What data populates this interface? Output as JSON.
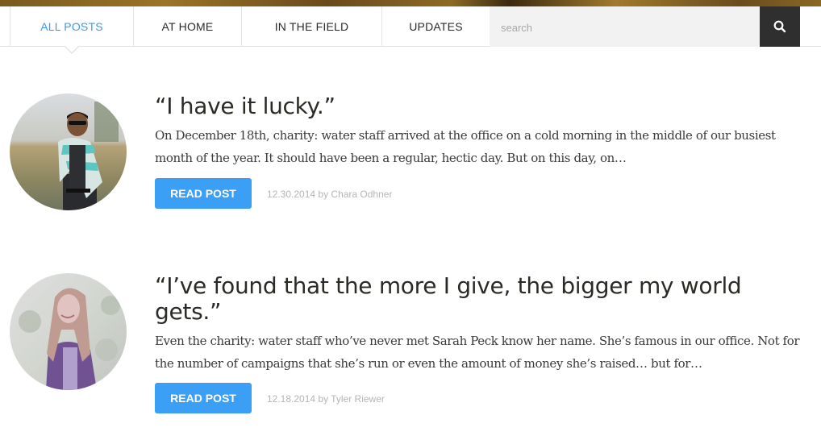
{
  "nav": {
    "tabs": [
      {
        "label": "ALL POSTS",
        "active": true
      },
      {
        "label": "AT HOME",
        "active": false
      },
      {
        "label": "IN THE FIELD",
        "active": false
      },
      {
        "label": "UPDATES",
        "active": false
      }
    ],
    "search": {
      "placeholder": "search",
      "value": "",
      "icon": "search-icon"
    }
  },
  "colors": {
    "accent": "#3a9bea",
    "button": "#3a9ff5",
    "search_button": "#2f2f2f",
    "meta_text": "#b5b5b5"
  },
  "posts": [
    {
      "title": "“I have it lucky.”",
      "excerpt": "On December 18th, charity: water staff arrived at the office on a cold morning in the middle of our busiest month of the year. It should have been a regular, hectic day. But on this day, on…",
      "button_label": "READ POST",
      "meta": "12.30.2014 by Chara Odhner"
    },
    {
      "title": "“I’ve found that the more I give, the bigger my world gets.”",
      "excerpt": "Even the charity: water staff who’ve never met Sarah Peck know her name. She’s famous in our office. Not for the number of campaigns that she’s run or even the amount of money she’s raised… but for…",
      "button_label": "READ POST",
      "meta": "12.18.2014 by Tyler Riewer"
    }
  ]
}
